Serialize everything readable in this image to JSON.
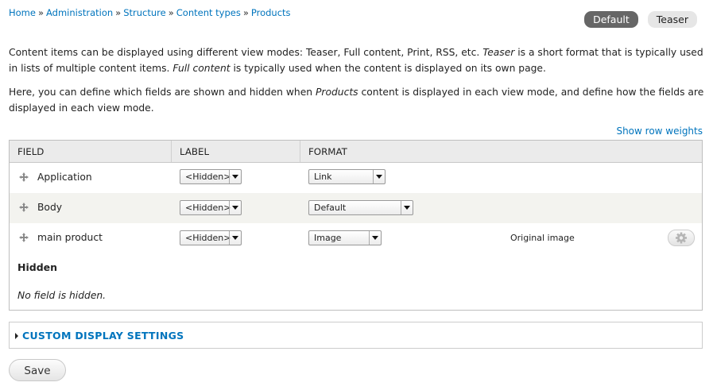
{
  "breadcrumb": {
    "items": [
      "Home",
      "Administration",
      "Structure",
      "Content types",
      "Products"
    ],
    "separator": "»"
  },
  "tabs": [
    {
      "label": "Default",
      "active": true
    },
    {
      "label": "Teaser",
      "active": false
    }
  ],
  "description": {
    "p1_a": "Content items can be displayed using different view modes: Teaser, Full content, Print, RSS, etc. ",
    "p1_em1": "Teaser",
    "p1_b": " is a short format that is typically used in lists of multiple content items. ",
    "p1_em2": "Full content",
    "p1_c": " is typically used when the content is displayed on its own page.",
    "p2_a": "Here, you can define which fields are shown and hidden when ",
    "p2_em": "Products",
    "p2_b": " content is displayed in each view mode, and define how the fields are displayed in each view mode."
  },
  "row_weights_link": "Show row weights",
  "table": {
    "headers": [
      "FIELD",
      "LABEL",
      "FORMAT"
    ],
    "rows": [
      {
        "field": "Application",
        "label": "<Hidden>",
        "format": "Link",
        "summary": ""
      },
      {
        "field": "Body",
        "label": "<Hidden>",
        "format": "Default",
        "summary": ""
      },
      {
        "field": "main product",
        "label": "<Hidden>",
        "format": "Image",
        "summary": "Original image"
      }
    ],
    "hidden_region": {
      "title": "Hidden",
      "empty_text": "No field is hidden."
    }
  },
  "custom_display": {
    "title": "CUSTOM DISPLAY SETTINGS",
    "collapsed": true
  },
  "save_button": "Save",
  "colors": {
    "link": "#0074bd",
    "active_tab": "#666666",
    "row_alt": "#f3f3ef"
  },
  "icons": {
    "drag": "move-arrows-icon",
    "settings": "gear-icon",
    "collapse": "triangle-right-icon"
  }
}
